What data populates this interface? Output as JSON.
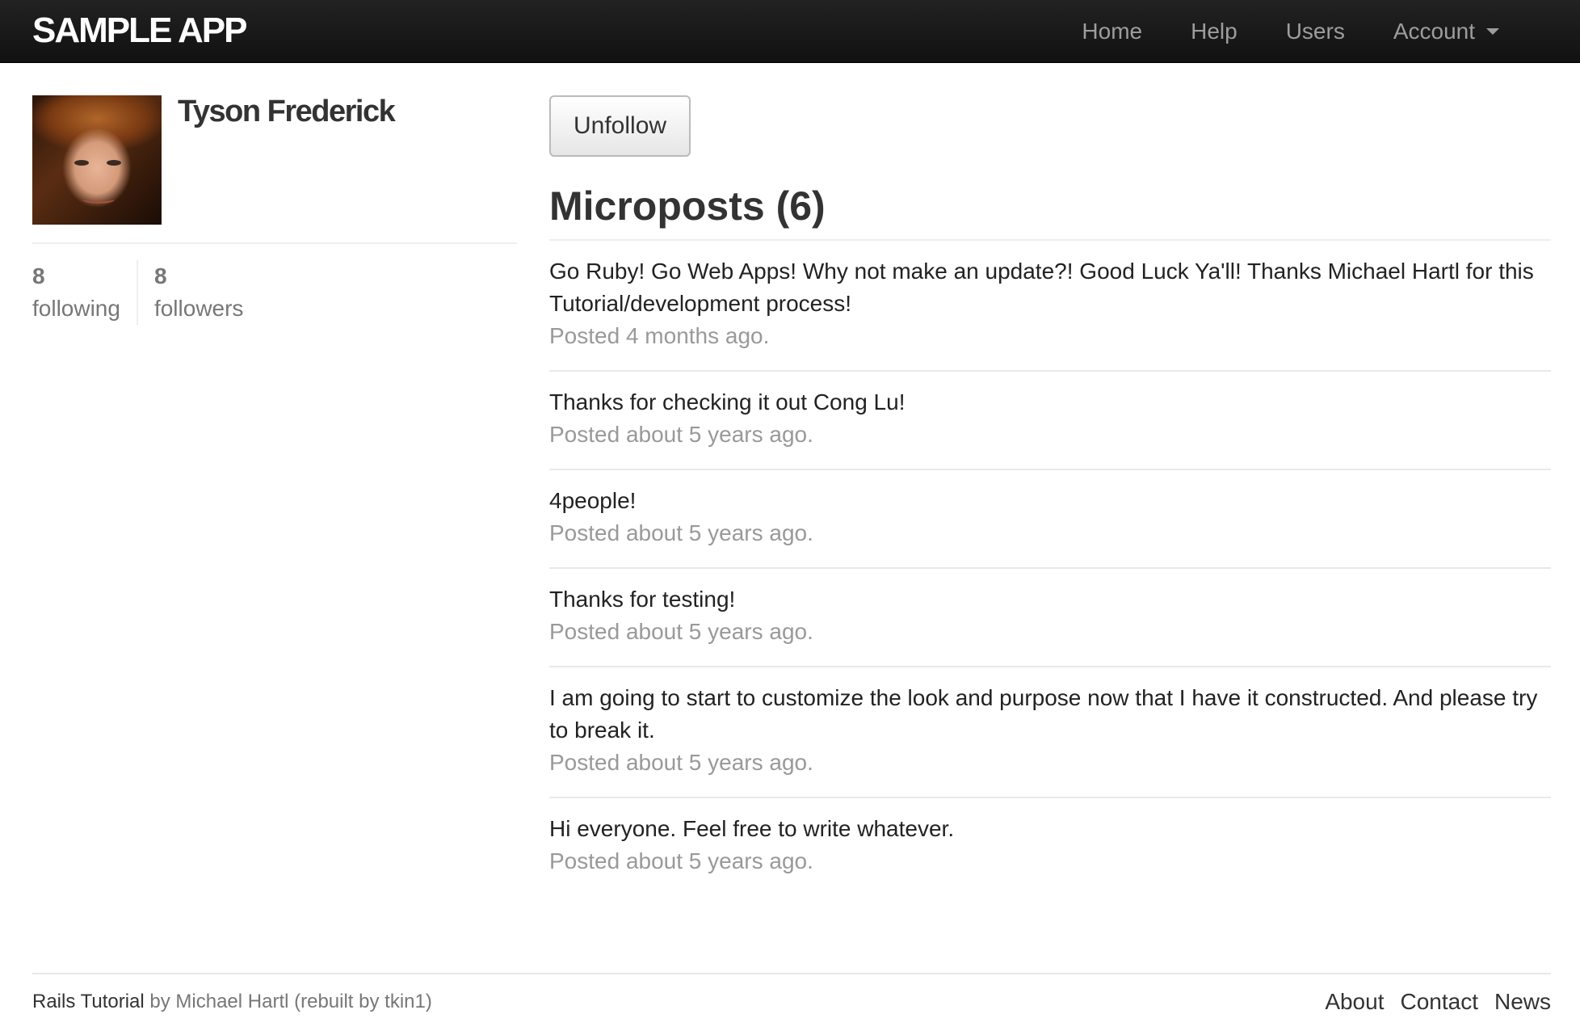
{
  "navbar": {
    "brand": "SAMPLE APP",
    "links": [
      {
        "label": "Home"
      },
      {
        "label": "Help"
      },
      {
        "label": "Users"
      },
      {
        "label": "Account"
      }
    ]
  },
  "profile": {
    "name": "Tyson Frederick",
    "following_count": "8",
    "following_label": "following",
    "followers_count": "8",
    "followers_label": "followers"
  },
  "main": {
    "unfollow_label": "Unfollow",
    "microposts_title": "Microposts (6)",
    "posts": [
      {
        "content": "Go Ruby! Go Web Apps! Why not make an update?! Good Luck Ya'll! Thanks Michael Hartl for this Tutorial/development process!",
        "time": "Posted 4 months ago."
      },
      {
        "content": "Thanks for checking it out Cong Lu!",
        "time": "Posted about 5 years ago."
      },
      {
        "content": "4people!",
        "time": "Posted about 5 years ago."
      },
      {
        "content": "Thanks for testing!",
        "time": "Posted about 5 years ago."
      },
      {
        "content": "I am going to start to customize the look and purpose now that I have it constructed. And please try to break it.",
        "time": "Posted about 5 years ago."
      },
      {
        "content": "Hi everyone. Feel free to write whatever.",
        "time": "Posted about 5 years ago."
      }
    ]
  },
  "footer": {
    "tutorial_link": "Rails Tutorial",
    "credit_rest": "by Michael Hartl (rebuilt by tkin1)",
    "links": [
      {
        "label": "About"
      },
      {
        "label": "Contact"
      },
      {
        "label": "News"
      }
    ]
  },
  "colors": {
    "navbar_bg": "#111111",
    "nav_link": "#9d9d9d",
    "muted_text": "#999999"
  }
}
